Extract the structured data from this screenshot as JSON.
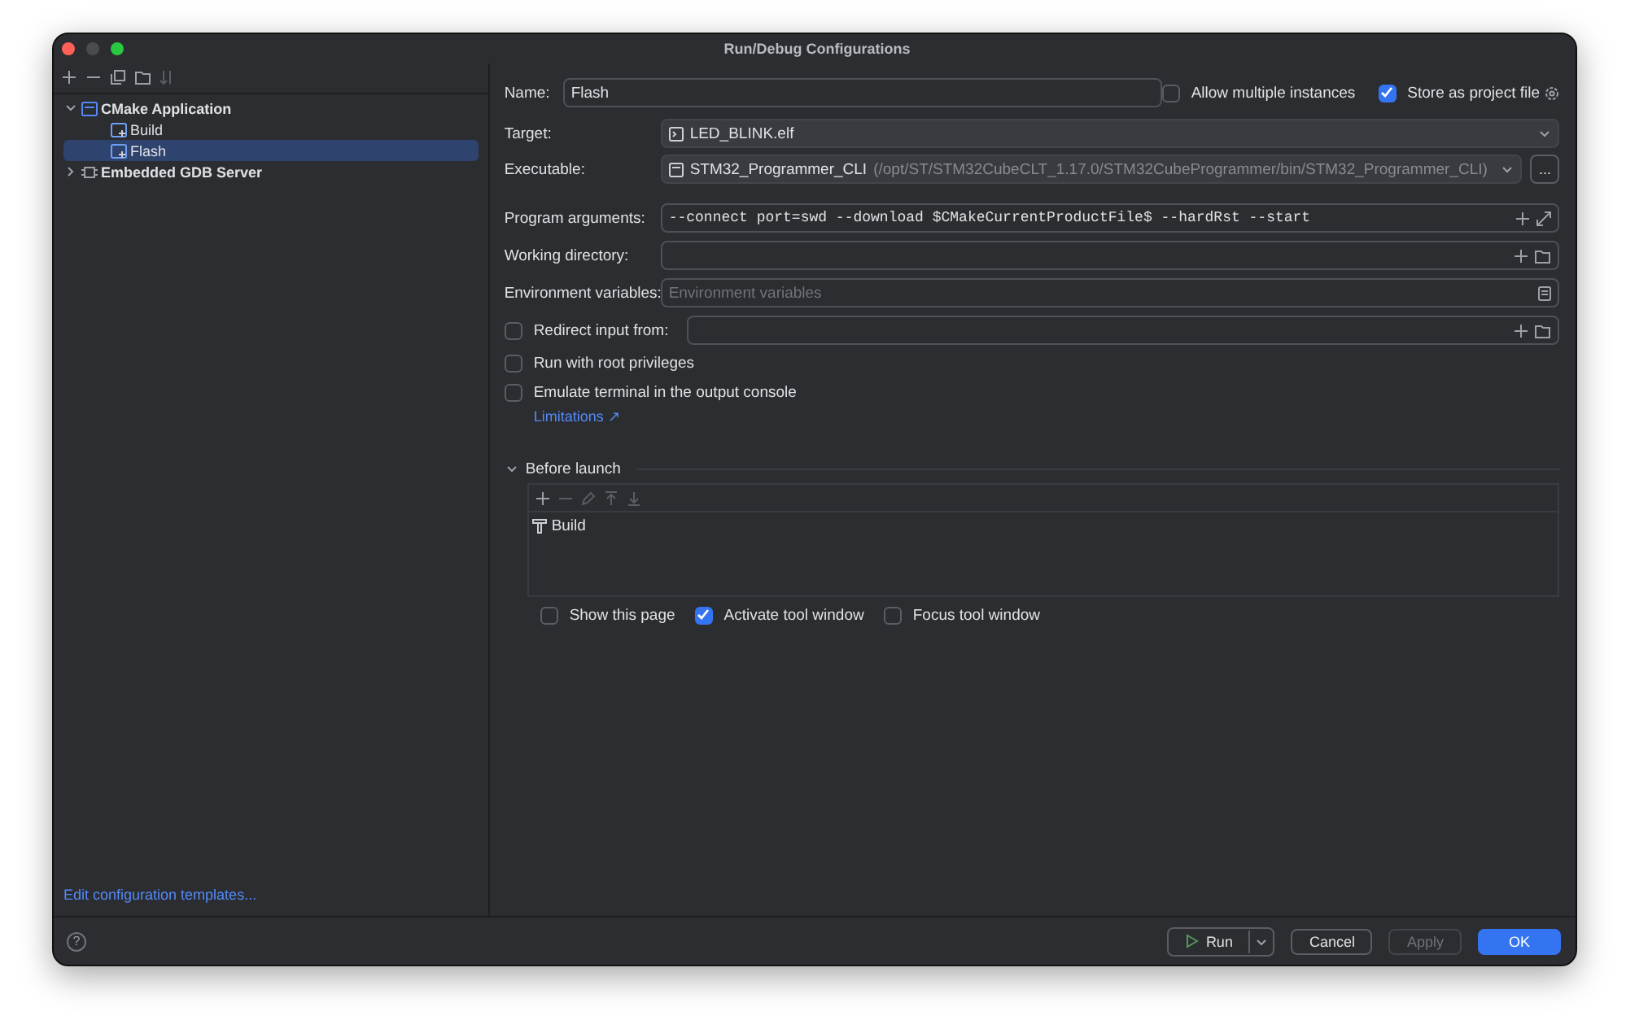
{
  "window": {
    "title": "Run/Debug Configurations"
  },
  "sidebar": {
    "tree": [
      {
        "label": "CMake Application",
        "kind": "group",
        "expanded": true,
        "selected": false,
        "children": [
          {
            "label": "Build",
            "kind": "config",
            "selected": false
          },
          {
            "label": "Flash",
            "kind": "config",
            "selected": true
          }
        ]
      },
      {
        "label": "Embedded GDB Server",
        "kind": "chip",
        "expanded": false,
        "selected": false
      }
    ],
    "link": "Edit configuration templates..."
  },
  "form": {
    "name": {
      "label": "Name:",
      "value": "Flash"
    },
    "allow_multiple": {
      "label": "Allow multiple instances",
      "checked": false
    },
    "store_project": {
      "label": "Store as project file",
      "checked": true
    },
    "target": {
      "label": "Target:",
      "value": "LED_BLINK.elf"
    },
    "executable": {
      "label": "Executable:",
      "value": "STM32_Programmer_CLI",
      "path": "(/opt/ST/STM32CubeCLT_1.17.0/STM32CubeProgrammer/bin/STM32_Programmer_CLI)",
      "browse": "..."
    },
    "program_arguments": {
      "label": "Program arguments:",
      "value": "--connect port=swd --download $CMakeCurrentProductFile$ --hardRst --start"
    },
    "working_directory": {
      "label": "Working directory:"
    },
    "environment_variables": {
      "label": "Environment variables:",
      "placeholder": "Environment variables"
    },
    "redirect_input": {
      "label": "Redirect input from:",
      "checked": false
    },
    "options": [
      {
        "label": "Run with root privileges",
        "checked": false
      },
      {
        "label": "Emulate terminal in the output console",
        "checked": false
      }
    ],
    "limitations_link": "Limitations ↗"
  },
  "before_launch": {
    "title": "Before launch",
    "expanded": true,
    "tasks": [
      {
        "label": "Build"
      }
    ],
    "options": [
      {
        "label": "Show this page",
        "checked": false
      },
      {
        "label": "Activate tool window",
        "checked": true
      },
      {
        "label": "Focus tool window",
        "checked": false
      }
    ]
  },
  "footer": {
    "help": "?",
    "buttons": [
      {
        "label": "Run",
        "kind": "run",
        "disabled": false
      },
      {
        "label": "Cancel",
        "kind": "normal",
        "disabled": false
      },
      {
        "label": "Apply",
        "kind": "normal",
        "disabled": true
      },
      {
        "label": "OK",
        "kind": "primary",
        "disabled": false
      }
    ]
  }
}
